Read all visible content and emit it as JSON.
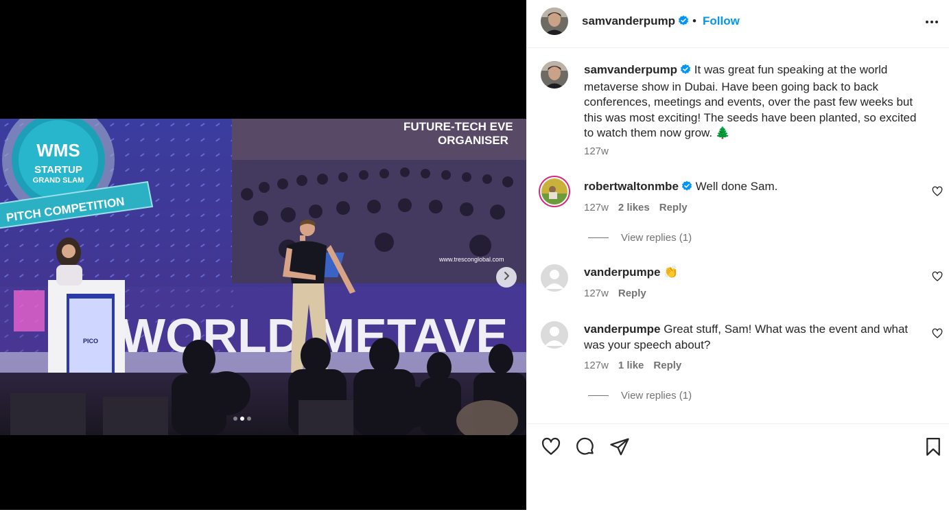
{
  "post": {
    "author": "samvanderpump",
    "follow_label": "Follow",
    "separator": "•",
    "caption": "It was great fun speaking at the world metaverse show in Dubai. Have been going back to back conferences, meetings and events, over the past few weeks but this was most exciting! The seeds have been planted, so excited to watch them now grow. 🌲",
    "caption_time": "127w"
  },
  "media": {
    "current_slide": 2,
    "total_slides": 3,
    "image_text": {
      "badge_title": "WMS",
      "badge_sub1": "STARTUP",
      "badge_sub2": "GRAND SLAM",
      "ribbon": "PITCH COMPETITION",
      "screen_title_1": "FUTURE-TECH EVE",
      "screen_title_2": "ORGANISER",
      "screen_url": "www.tresconglobal.com",
      "stage_text": "WORLD METAVE",
      "podium_logo": "PICO"
    }
  },
  "comments": [
    {
      "user": "robertwaltonmbe",
      "verified": true,
      "text": "Well done Sam.",
      "time": "127w",
      "likes": "2 likes",
      "reply": "Reply",
      "view_replies": "View replies (1)"
    },
    {
      "user": "vanderpumpe",
      "verified": false,
      "text": "👏",
      "time": "127w",
      "reply": "Reply"
    },
    {
      "user": "vanderpumpe",
      "verified": false,
      "text": "Great stuff, Sam! What was the event and what was your speech about?",
      "time": "127w",
      "likes": "1 like",
      "reply": "Reply",
      "view_replies": "View replies (1)"
    }
  ],
  "icons": {
    "like": "heart-icon",
    "comment": "comment-bubble-icon",
    "share": "paper-plane-icon",
    "save": "bookmark-icon",
    "more": "more-horizontal-icon",
    "next": "chevron-right-icon"
  },
  "colors": {
    "follow_blue": "#0095f6",
    "verified_blue": "#0095f6",
    "muted_text": "#737373"
  }
}
